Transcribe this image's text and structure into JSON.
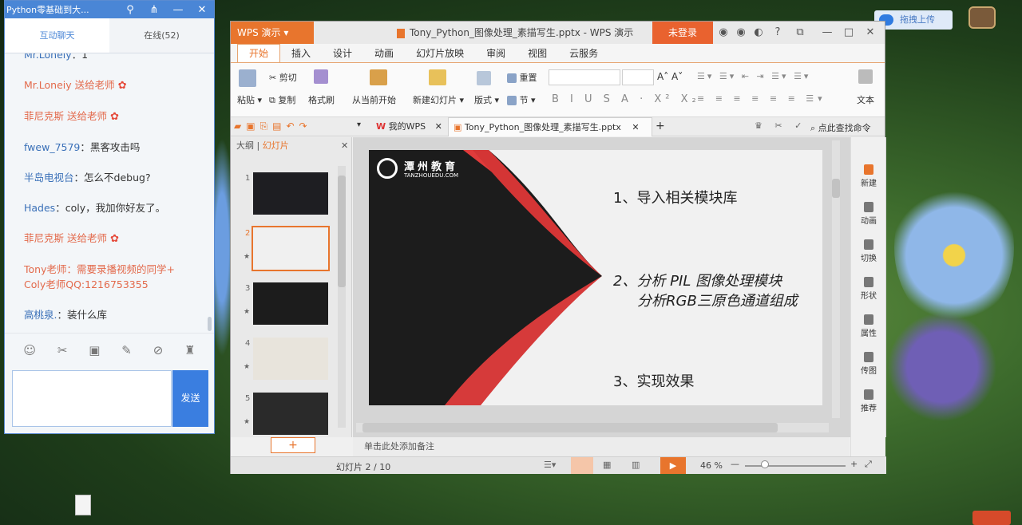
{
  "chat": {
    "title": "Python零基础到大...",
    "tabs": [
      "互动聊天",
      "在线(52)"
    ],
    "messages": [
      {
        "name": "Mr.Lonely",
        "sep": "：",
        "text": "1",
        "style": "blue"
      },
      {
        "name": "Mr.Loneiy 送给老师",
        "sep": "",
        "text": "",
        "style": "pink",
        "rose": true
      },
      {
        "name": "菲尼克斯 送给老师",
        "sep": "",
        "text": "",
        "style": "pink",
        "rose": true
      },
      {
        "name": "fwew_7579",
        "sep": "：",
        "text": "黑客攻击吗",
        "style": "blue"
      },
      {
        "name": "半岛电视台",
        "sep": "：",
        "text": "怎么不debug?",
        "style": "blue"
      },
      {
        "name": "Hades",
        "sep": "：",
        "text": "coly，我加你好友了。",
        "style": "blue"
      },
      {
        "name": "菲尼克斯 送给老师",
        "sep": "",
        "text": "",
        "style": "pink",
        "rose": true
      },
      {
        "name": "Tony老师：需要录播视频的同学+",
        "sep": "",
        "text": "",
        "style": "pink"
      },
      {
        "name": "Coly老师QQ:1216753355",
        "sep": "",
        "text": "",
        "style": "pink"
      },
      {
        "name": "高桃泉.",
        "sep": "：",
        "text": "装什么库",
        "style": "blue"
      }
    ],
    "send_label": "发送"
  },
  "cloud_upload": "拖拽上传",
  "wps": {
    "logo": "WPS 演示",
    "file_title": "Tony_Python_图像处理_素描写生.pptx - WPS 演示",
    "login": "未登录",
    "menu": [
      "开始",
      "插入",
      "设计",
      "动画",
      "幻灯片放映",
      "审阅",
      "视图",
      "云服务"
    ],
    "ribbon": {
      "paste": "粘贴",
      "cut": "剪切",
      "copy": "复制",
      "format_painter": "格式刷",
      "from_current": "从当前开始",
      "new_slide": "新建幻灯片",
      "layout": "版式",
      "reset": "重置",
      "section": "节",
      "textbox": "文本"
    },
    "tabs": {
      "my_wps": "我的WPS",
      "doc": "Tony_Python_图像处理_素描写生.pptx",
      "search": "点此查找命令"
    },
    "panel_tabs": [
      "大纲",
      "幻灯片"
    ],
    "slide_numbers": [
      "1",
      "2",
      "3",
      "4",
      "5"
    ],
    "slide": {
      "logo_cn": "潭州教育",
      "logo_en": "TANZHOUEDU.COM",
      "line1": "1、导入相关模块库",
      "line2a": "2、分析 PIL 图像处理模块",
      "line2b": "分析RGB三原色通道组成",
      "line3": "3、实现效果"
    },
    "side_tools": [
      "新建",
      "动画",
      "切换",
      "形状",
      "属性",
      "传图",
      "推荐"
    ],
    "notes_placeholder": "单击此处添加备注",
    "status": {
      "slide_info": "幻灯片 2 / 10",
      "zoom": "46 %"
    }
  }
}
